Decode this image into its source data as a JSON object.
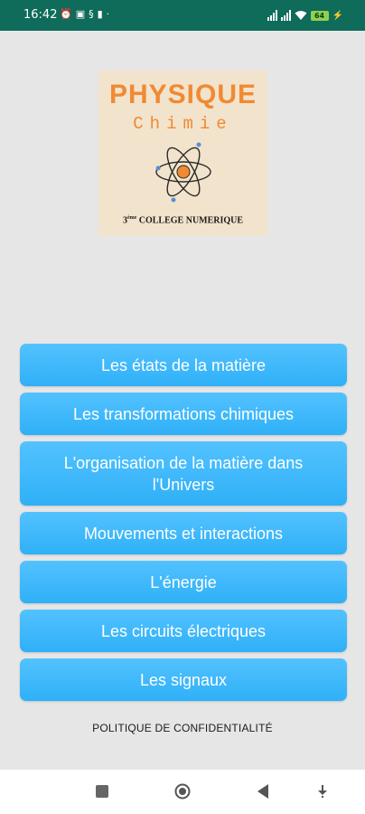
{
  "status_bar": {
    "time": "16:42",
    "left_icons": [
      "alarm-icon",
      "message-icon",
      "sync-icon",
      "file-icon",
      "dot-icon"
    ],
    "battery_level": "64",
    "right_icons": [
      "signal-icon",
      "signal-icon",
      "wifi-icon",
      "battery-icon",
      "charging-icon"
    ]
  },
  "logo": {
    "title": "PHYSIQUE",
    "subtitle": "Chimie",
    "level_number": "3",
    "level_suffix": "ème",
    "school_text": "COLLEGE NUMERIQUE",
    "color": "#f08a33"
  },
  "menu": {
    "items": [
      {
        "label": "Les états de la matière"
      },
      {
        "label": "Les transformations chimiques"
      },
      {
        "label_line1": "L'organisation de la matière dans",
        "label_line2": "l'Univers"
      },
      {
        "label": "Mouvements et interactions"
      },
      {
        "label": "L'énergie"
      },
      {
        "label": "Les circuits électriques"
      },
      {
        "label": "Les signaux"
      }
    ],
    "button_color": "#3db8fb"
  },
  "policy_link": "POLITIQUE DE CONFIDENTIALITÉ",
  "nav_bar": {
    "icons": [
      "recent-apps-icon",
      "home-icon",
      "back-icon",
      "dropdown-icon"
    ]
  }
}
